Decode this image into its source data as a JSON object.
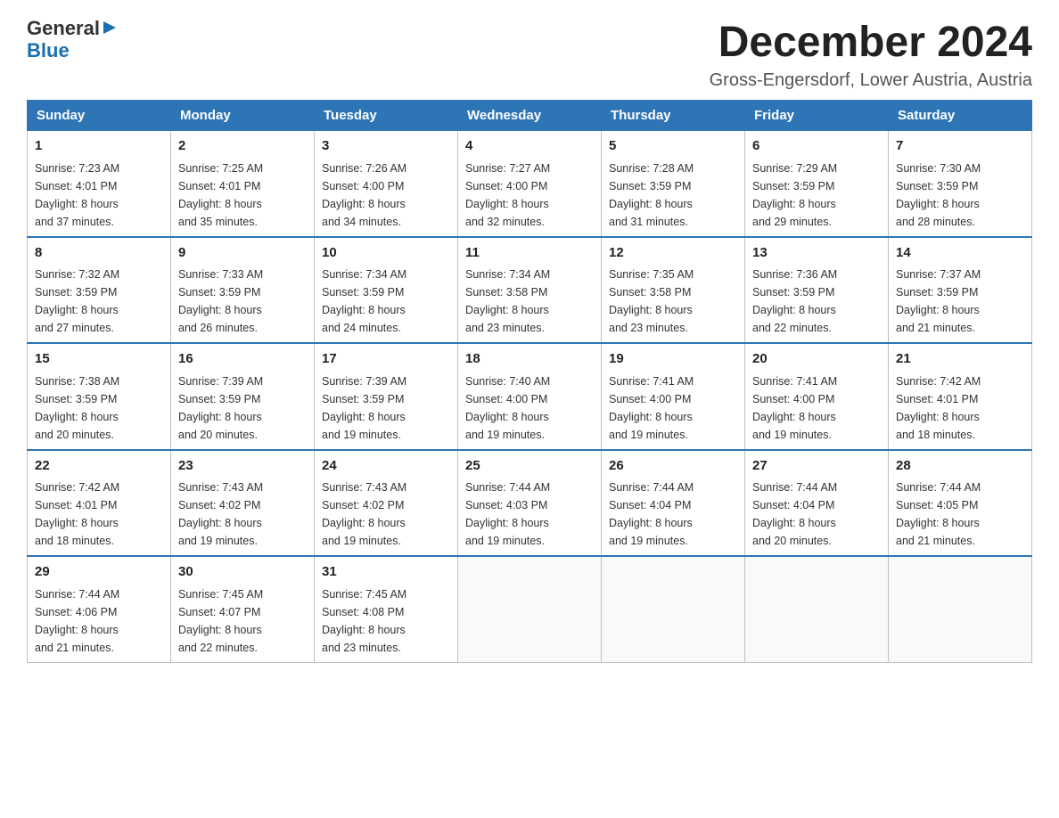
{
  "logo": {
    "general": "General",
    "blue": "Blue"
  },
  "title": "December 2024",
  "subtitle": "Gross-Engersdorf, Lower Austria, Austria",
  "days_of_week": [
    "Sunday",
    "Monday",
    "Tuesday",
    "Wednesday",
    "Thursday",
    "Friday",
    "Saturday"
  ],
  "weeks": [
    [
      {
        "day": "1",
        "sunrise": "7:23 AM",
        "sunset": "4:01 PM",
        "daylight": "8 hours and 37 minutes."
      },
      {
        "day": "2",
        "sunrise": "7:25 AM",
        "sunset": "4:01 PM",
        "daylight": "8 hours and 35 minutes."
      },
      {
        "day": "3",
        "sunrise": "7:26 AM",
        "sunset": "4:00 PM",
        "daylight": "8 hours and 34 minutes."
      },
      {
        "day": "4",
        "sunrise": "7:27 AM",
        "sunset": "4:00 PM",
        "daylight": "8 hours and 32 minutes."
      },
      {
        "day": "5",
        "sunrise": "7:28 AM",
        "sunset": "3:59 PM",
        "daylight": "8 hours and 31 minutes."
      },
      {
        "day": "6",
        "sunrise": "7:29 AM",
        "sunset": "3:59 PM",
        "daylight": "8 hours and 29 minutes."
      },
      {
        "day": "7",
        "sunrise": "7:30 AM",
        "sunset": "3:59 PM",
        "daylight": "8 hours and 28 minutes."
      }
    ],
    [
      {
        "day": "8",
        "sunrise": "7:32 AM",
        "sunset": "3:59 PM",
        "daylight": "8 hours and 27 minutes."
      },
      {
        "day": "9",
        "sunrise": "7:33 AM",
        "sunset": "3:59 PM",
        "daylight": "8 hours and 26 minutes."
      },
      {
        "day": "10",
        "sunrise": "7:34 AM",
        "sunset": "3:59 PM",
        "daylight": "8 hours and 24 minutes."
      },
      {
        "day": "11",
        "sunrise": "7:34 AM",
        "sunset": "3:58 PM",
        "daylight": "8 hours and 23 minutes."
      },
      {
        "day": "12",
        "sunrise": "7:35 AM",
        "sunset": "3:58 PM",
        "daylight": "8 hours and 23 minutes."
      },
      {
        "day": "13",
        "sunrise": "7:36 AM",
        "sunset": "3:59 PM",
        "daylight": "8 hours and 22 minutes."
      },
      {
        "day": "14",
        "sunrise": "7:37 AM",
        "sunset": "3:59 PM",
        "daylight": "8 hours and 21 minutes."
      }
    ],
    [
      {
        "day": "15",
        "sunrise": "7:38 AM",
        "sunset": "3:59 PM",
        "daylight": "8 hours and 20 minutes."
      },
      {
        "day": "16",
        "sunrise": "7:39 AM",
        "sunset": "3:59 PM",
        "daylight": "8 hours and 20 minutes."
      },
      {
        "day": "17",
        "sunrise": "7:39 AM",
        "sunset": "3:59 PM",
        "daylight": "8 hours and 19 minutes."
      },
      {
        "day": "18",
        "sunrise": "7:40 AM",
        "sunset": "4:00 PM",
        "daylight": "8 hours and 19 minutes."
      },
      {
        "day": "19",
        "sunrise": "7:41 AM",
        "sunset": "4:00 PM",
        "daylight": "8 hours and 19 minutes."
      },
      {
        "day": "20",
        "sunrise": "7:41 AM",
        "sunset": "4:00 PM",
        "daylight": "8 hours and 19 minutes."
      },
      {
        "day": "21",
        "sunrise": "7:42 AM",
        "sunset": "4:01 PM",
        "daylight": "8 hours and 18 minutes."
      }
    ],
    [
      {
        "day": "22",
        "sunrise": "7:42 AM",
        "sunset": "4:01 PM",
        "daylight": "8 hours and 18 minutes."
      },
      {
        "day": "23",
        "sunrise": "7:43 AM",
        "sunset": "4:02 PM",
        "daylight": "8 hours and 19 minutes."
      },
      {
        "day": "24",
        "sunrise": "7:43 AM",
        "sunset": "4:02 PM",
        "daylight": "8 hours and 19 minutes."
      },
      {
        "day": "25",
        "sunrise": "7:44 AM",
        "sunset": "4:03 PM",
        "daylight": "8 hours and 19 minutes."
      },
      {
        "day": "26",
        "sunrise": "7:44 AM",
        "sunset": "4:04 PM",
        "daylight": "8 hours and 19 minutes."
      },
      {
        "day": "27",
        "sunrise": "7:44 AM",
        "sunset": "4:04 PM",
        "daylight": "8 hours and 20 minutes."
      },
      {
        "day": "28",
        "sunrise": "7:44 AM",
        "sunset": "4:05 PM",
        "daylight": "8 hours and 21 minutes."
      }
    ],
    [
      {
        "day": "29",
        "sunrise": "7:44 AM",
        "sunset": "4:06 PM",
        "daylight": "8 hours and 21 minutes."
      },
      {
        "day": "30",
        "sunrise": "7:45 AM",
        "sunset": "4:07 PM",
        "daylight": "8 hours and 22 minutes."
      },
      {
        "day": "31",
        "sunrise": "7:45 AM",
        "sunset": "4:08 PM",
        "daylight": "8 hours and 23 minutes."
      },
      null,
      null,
      null,
      null
    ]
  ]
}
